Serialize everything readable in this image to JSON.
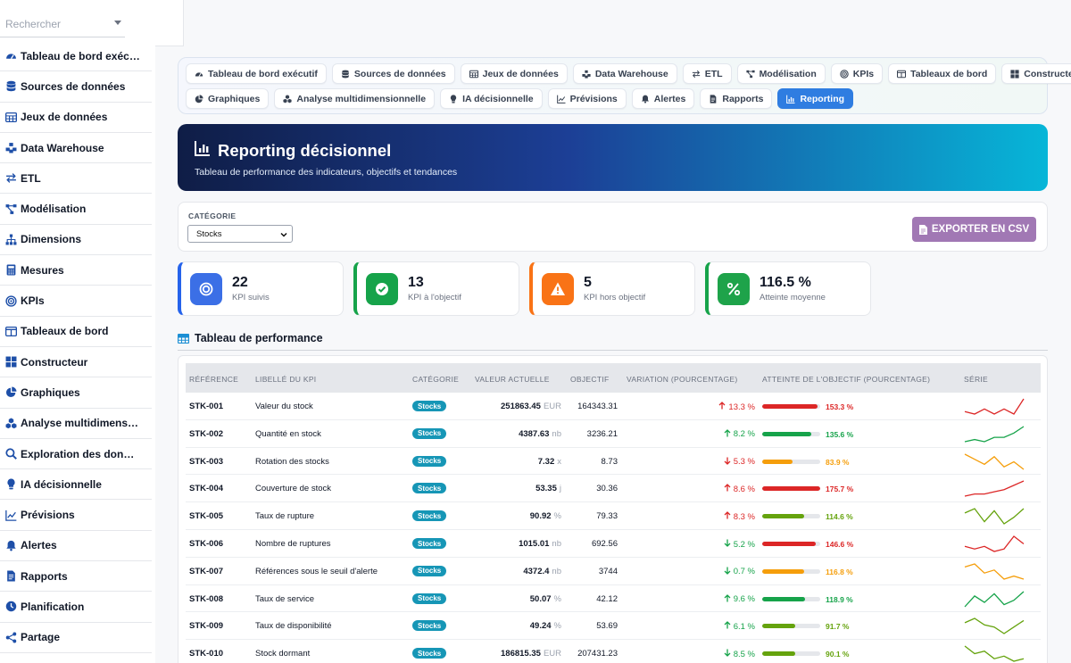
{
  "sidebar": {
    "search_placeholder": "Rechercher",
    "items": [
      {
        "label": "Tableau de bord exéc…",
        "icon": "gauge-icon"
      },
      {
        "label": "Sources de données",
        "icon": "database-icon"
      },
      {
        "label": "Jeux de données",
        "icon": "table-icon"
      },
      {
        "label": "Data Warehouse",
        "icon": "warehouse-icon"
      },
      {
        "label": "ETL",
        "icon": "exchange-icon"
      },
      {
        "label": "Modélisation",
        "icon": "nodes-icon"
      },
      {
        "label": "Dimensions",
        "icon": "sitemap-icon"
      },
      {
        "label": "Mesures",
        "icon": "calculator-icon"
      },
      {
        "label": "KPIs",
        "icon": "target-icon"
      },
      {
        "label": "Tableaux de bord",
        "icon": "columns-icon"
      },
      {
        "label": "Constructeur",
        "icon": "grid-icon"
      },
      {
        "label": "Graphiques",
        "icon": "pie-icon"
      },
      {
        "label": "Analyse multidimens…",
        "icon": "cubes-icon"
      },
      {
        "label": "Exploration des don…",
        "icon": "search-icon"
      },
      {
        "label": "IA décisionnelle",
        "icon": "bulb-icon"
      },
      {
        "label": "Prévisions",
        "icon": "line-chart-icon"
      },
      {
        "label": "Alertes",
        "icon": "bell-icon"
      },
      {
        "label": "Rapports",
        "icon": "document-icon"
      },
      {
        "label": "Planification",
        "icon": "clock-icon"
      },
      {
        "label": "Partage",
        "icon": "share-icon"
      }
    ]
  },
  "tabs": {
    "row1": [
      {
        "label": "Tableau de bord exécutif",
        "icon": "gauge-icon"
      },
      {
        "label": "Sources de données",
        "icon": "database-icon"
      },
      {
        "label": "Jeux de données",
        "icon": "table-icon"
      },
      {
        "label": "Data Warehouse",
        "icon": "warehouse-icon"
      },
      {
        "label": "ETL",
        "icon": "exchange-icon"
      },
      {
        "label": "Modélisation",
        "icon": "nodes-icon"
      },
      {
        "label": "KPIs",
        "icon": "target-icon"
      },
      {
        "label": "Tableaux de bord",
        "icon": "columns-icon"
      },
      {
        "label": "Constructeur",
        "icon": "grid-icon"
      }
    ],
    "row2": [
      {
        "label": "Graphiques",
        "icon": "pie-icon"
      },
      {
        "label": "Analyse multidimensionnelle",
        "icon": "cubes-icon"
      },
      {
        "label": "IA décisionnelle",
        "icon": "bulb-icon"
      },
      {
        "label": "Prévisions",
        "icon": "line-chart-icon"
      },
      {
        "label": "Alertes",
        "icon": "bell-icon"
      },
      {
        "label": "Rapports",
        "icon": "document-icon"
      },
      {
        "label": "Reporting",
        "icon": "bar-chart-icon",
        "active": true
      }
    ]
  },
  "hero": {
    "title": "Reporting décisionnel",
    "subtitle": "Tableau de performance des indicateurs, objectifs et tendances"
  },
  "filter": {
    "label": "CATÉGORIE",
    "selected": "Stocks",
    "export_label": "EXPORTER EN CSV"
  },
  "stats": [
    {
      "value": "22",
      "label": "KPI suivis",
      "color": "#2563eb",
      "icon": "target-icon"
    },
    {
      "value": "13",
      "label": "KPI à l'objectif",
      "color": "#16a34a",
      "icon": "check-icon"
    },
    {
      "value": "5",
      "label": "KPI hors objectif",
      "color": "#f97316",
      "icon": "warning-icon"
    },
    {
      "value": "116.5 %",
      "label": "Atteinte moyenne",
      "color": "#16a34a",
      "icon": "percent-icon"
    }
  ],
  "section_title": "Tableau de performance",
  "table": {
    "headers": [
      "RÉFÉRENCE",
      "LIBELLÉ DU KPI",
      "CATÉGORIE",
      "VALEUR ACTUELLE",
      "OBJECTIF",
      "VARIATION (POURCENTAGE)",
      "ATTEINTE DE L'OBJECTIF (POURCENTAGE)",
      "SÉRIE"
    ],
    "rows": [
      {
        "ref": "STK-001",
        "label": "Valeur du stock",
        "cat": "Stocks",
        "value": "251863.45",
        "unit": "EUR",
        "target": "164343.31",
        "var": "13.3 %",
        "dir": "up",
        "var_color": "#dc2626",
        "att": 153.3,
        "att_label": "153.3 %",
        "att_color": "#dc2626",
        "series": [
          5,
          4,
          6,
          4,
          6,
          4,
          10
        ]
      },
      {
        "ref": "STK-002",
        "label": "Quantité en stock",
        "cat": "Stocks",
        "value": "4387.63",
        "unit": "nb",
        "target": "3236.21",
        "var": "8.2 %",
        "dir": "up",
        "var_color": "#16a34a",
        "att": 135.6,
        "att_label": "135.6 %",
        "att_color": "#16a34a",
        "series": [
          3,
          4,
          3,
          5,
          5,
          7,
          10
        ]
      },
      {
        "ref": "STK-003",
        "label": "Rotation des stocks",
        "cat": "Stocks",
        "value": "7.32",
        "unit": "x",
        "target": "8.73",
        "var": "5.3 %",
        "dir": "down",
        "var_color": "#dc2626",
        "att": 83.9,
        "att_label": "83.9 %",
        "att_color": "#f59e0b",
        "series": [
          10,
          8,
          6,
          9,
          5,
          7,
          4
        ]
      },
      {
        "ref": "STK-004",
        "label": "Couverture de stock",
        "cat": "Stocks",
        "value": "53.35",
        "unit": "j",
        "target": "30.36",
        "var": "8.6 %",
        "dir": "up",
        "var_color": "#dc2626",
        "att": 175.7,
        "att_label": "175.7 %",
        "att_color": "#dc2626",
        "series": [
          3,
          4,
          4,
          5,
          6,
          8,
          10
        ]
      },
      {
        "ref": "STK-005",
        "label": "Taux de rupture",
        "cat": "Stocks",
        "value": "90.92",
        "unit": "%",
        "target": "79.33",
        "var": "8.3 %",
        "dir": "up",
        "var_color": "#dc2626",
        "att": 114.6,
        "att_label": "114.6 %",
        "att_color": "#65a30d",
        "series": [
          8,
          10,
          4,
          9,
          3,
          6,
          10
        ]
      },
      {
        "ref": "STK-006",
        "label": "Nombre de ruptures",
        "cat": "Stocks",
        "value": "1015.01",
        "unit": "nb",
        "target": "692.56",
        "var": "5.2 %",
        "dir": "down",
        "var_color": "#16a34a",
        "att": 146.6,
        "att_label": "146.6 %",
        "att_color": "#dc2626",
        "series": [
          5,
          4,
          5,
          3,
          4,
          9,
          6
        ]
      },
      {
        "ref": "STK-007",
        "label": "Références sous le seuil d'alerte",
        "cat": "Stocks",
        "value": "4372.4",
        "unit": "nb",
        "target": "3744",
        "var": "0.7 %",
        "dir": "down",
        "var_color": "#16a34a",
        "att": 116.8,
        "att_label": "116.8 %",
        "att_color": "#f59e0b",
        "series": [
          9,
          10,
          7,
          8,
          5,
          6,
          5
        ]
      },
      {
        "ref": "STK-008",
        "label": "Taux de service",
        "cat": "Stocks",
        "value": "50.07",
        "unit": "%",
        "target": "42.12",
        "var": "9.6 %",
        "dir": "up",
        "var_color": "#16a34a",
        "att": 118.9,
        "att_label": "118.9 %",
        "att_color": "#16a34a",
        "series": [
          3,
          8,
          5,
          9,
          4,
          6,
          10
        ]
      },
      {
        "ref": "STK-009",
        "label": "Taux de disponibilité",
        "cat": "Stocks",
        "value": "49.24",
        "unit": "%",
        "target": "53.69",
        "var": "6.1 %",
        "dir": "up",
        "var_color": "#16a34a",
        "att": 91.7,
        "att_label": "91.7 %",
        "att_color": "#65a30d",
        "series": [
          8,
          10,
          7,
          6,
          3,
          6,
          9
        ]
      },
      {
        "ref": "STK-010",
        "label": "Stock dormant",
        "cat": "Stocks",
        "value": "186815.35",
        "unit": "EUR",
        "target": "207431.23",
        "var": "8.5 %",
        "dir": "down",
        "var_color": "#16a34a",
        "att": 90.1,
        "att_label": "90.1 %",
        "att_color": "#65a30d",
        "series": [
          10,
          7,
          8,
          5,
          6,
          4,
          5
        ]
      }
    ]
  }
}
